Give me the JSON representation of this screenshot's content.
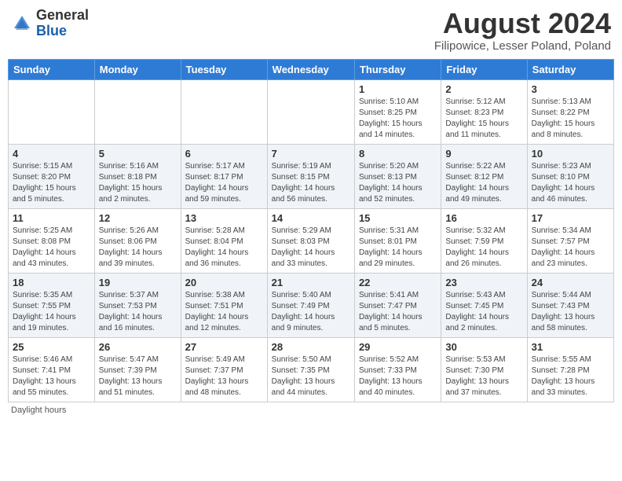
{
  "header": {
    "logo_general": "General",
    "logo_blue": "Blue",
    "month_year": "August 2024",
    "location": "Filipowice, Lesser Poland, Poland"
  },
  "days_of_week": [
    "Sunday",
    "Monday",
    "Tuesday",
    "Wednesday",
    "Thursday",
    "Friday",
    "Saturday"
  ],
  "footnote": "Daylight hours",
  "weeks": [
    [
      {
        "num": "",
        "info": ""
      },
      {
        "num": "",
        "info": ""
      },
      {
        "num": "",
        "info": ""
      },
      {
        "num": "",
        "info": ""
      },
      {
        "num": "1",
        "info": "Sunrise: 5:10 AM\nSunset: 8:25 PM\nDaylight: 15 hours\nand 14 minutes."
      },
      {
        "num": "2",
        "info": "Sunrise: 5:12 AM\nSunset: 8:23 PM\nDaylight: 15 hours\nand 11 minutes."
      },
      {
        "num": "3",
        "info": "Sunrise: 5:13 AM\nSunset: 8:22 PM\nDaylight: 15 hours\nand 8 minutes."
      }
    ],
    [
      {
        "num": "4",
        "info": "Sunrise: 5:15 AM\nSunset: 8:20 PM\nDaylight: 15 hours\nand 5 minutes."
      },
      {
        "num": "5",
        "info": "Sunrise: 5:16 AM\nSunset: 8:18 PM\nDaylight: 15 hours\nand 2 minutes."
      },
      {
        "num": "6",
        "info": "Sunrise: 5:17 AM\nSunset: 8:17 PM\nDaylight: 14 hours\nand 59 minutes."
      },
      {
        "num": "7",
        "info": "Sunrise: 5:19 AM\nSunset: 8:15 PM\nDaylight: 14 hours\nand 56 minutes."
      },
      {
        "num": "8",
        "info": "Sunrise: 5:20 AM\nSunset: 8:13 PM\nDaylight: 14 hours\nand 52 minutes."
      },
      {
        "num": "9",
        "info": "Sunrise: 5:22 AM\nSunset: 8:12 PM\nDaylight: 14 hours\nand 49 minutes."
      },
      {
        "num": "10",
        "info": "Sunrise: 5:23 AM\nSunset: 8:10 PM\nDaylight: 14 hours\nand 46 minutes."
      }
    ],
    [
      {
        "num": "11",
        "info": "Sunrise: 5:25 AM\nSunset: 8:08 PM\nDaylight: 14 hours\nand 43 minutes."
      },
      {
        "num": "12",
        "info": "Sunrise: 5:26 AM\nSunset: 8:06 PM\nDaylight: 14 hours\nand 39 minutes."
      },
      {
        "num": "13",
        "info": "Sunrise: 5:28 AM\nSunset: 8:04 PM\nDaylight: 14 hours\nand 36 minutes."
      },
      {
        "num": "14",
        "info": "Sunrise: 5:29 AM\nSunset: 8:03 PM\nDaylight: 14 hours\nand 33 minutes."
      },
      {
        "num": "15",
        "info": "Sunrise: 5:31 AM\nSunset: 8:01 PM\nDaylight: 14 hours\nand 29 minutes."
      },
      {
        "num": "16",
        "info": "Sunrise: 5:32 AM\nSunset: 7:59 PM\nDaylight: 14 hours\nand 26 minutes."
      },
      {
        "num": "17",
        "info": "Sunrise: 5:34 AM\nSunset: 7:57 PM\nDaylight: 14 hours\nand 23 minutes."
      }
    ],
    [
      {
        "num": "18",
        "info": "Sunrise: 5:35 AM\nSunset: 7:55 PM\nDaylight: 14 hours\nand 19 minutes."
      },
      {
        "num": "19",
        "info": "Sunrise: 5:37 AM\nSunset: 7:53 PM\nDaylight: 14 hours\nand 16 minutes."
      },
      {
        "num": "20",
        "info": "Sunrise: 5:38 AM\nSunset: 7:51 PM\nDaylight: 14 hours\nand 12 minutes."
      },
      {
        "num": "21",
        "info": "Sunrise: 5:40 AM\nSunset: 7:49 PM\nDaylight: 14 hours\nand 9 minutes."
      },
      {
        "num": "22",
        "info": "Sunrise: 5:41 AM\nSunset: 7:47 PM\nDaylight: 14 hours\nand 5 minutes."
      },
      {
        "num": "23",
        "info": "Sunrise: 5:43 AM\nSunset: 7:45 PM\nDaylight: 14 hours\nand 2 minutes."
      },
      {
        "num": "24",
        "info": "Sunrise: 5:44 AM\nSunset: 7:43 PM\nDaylight: 13 hours\nand 58 minutes."
      }
    ],
    [
      {
        "num": "25",
        "info": "Sunrise: 5:46 AM\nSunset: 7:41 PM\nDaylight: 13 hours\nand 55 minutes."
      },
      {
        "num": "26",
        "info": "Sunrise: 5:47 AM\nSunset: 7:39 PM\nDaylight: 13 hours\nand 51 minutes."
      },
      {
        "num": "27",
        "info": "Sunrise: 5:49 AM\nSunset: 7:37 PM\nDaylight: 13 hours\nand 48 minutes."
      },
      {
        "num": "28",
        "info": "Sunrise: 5:50 AM\nSunset: 7:35 PM\nDaylight: 13 hours\nand 44 minutes."
      },
      {
        "num": "29",
        "info": "Sunrise: 5:52 AM\nSunset: 7:33 PM\nDaylight: 13 hours\nand 40 minutes."
      },
      {
        "num": "30",
        "info": "Sunrise: 5:53 AM\nSunset: 7:30 PM\nDaylight: 13 hours\nand 37 minutes."
      },
      {
        "num": "31",
        "info": "Sunrise: 5:55 AM\nSunset: 7:28 PM\nDaylight: 13 hours\nand 33 minutes."
      }
    ]
  ]
}
